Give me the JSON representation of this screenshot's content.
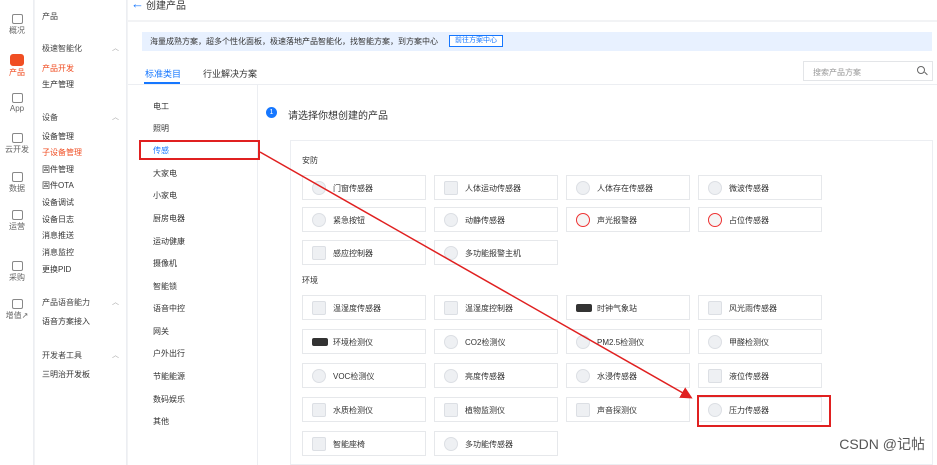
{
  "rail": [
    {
      "name": "rail-overview",
      "label": "概况",
      "active": false
    },
    {
      "name": "rail-product",
      "label": "产品",
      "active": true
    },
    {
      "name": "rail-app",
      "label": "App",
      "active": false
    },
    {
      "name": "rail-cloud",
      "label": "云开发",
      "active": false
    },
    {
      "name": "rail-data",
      "label": "数据",
      "active": false
    },
    {
      "name": "rail-ops",
      "label": "运营",
      "active": false
    },
    {
      "name": "rail-purchase",
      "label": "采购",
      "active": false
    },
    {
      "name": "rail-value-add",
      "label": "增值↗",
      "active": false
    }
  ],
  "menu": {
    "section_product": "产品",
    "group_fast": "极速智能化",
    "item_dev": "产品开发",
    "item_manage": "生产管理",
    "group_device": "设备",
    "device_items": [
      "设备管理",
      "子设备管理",
      "固件管理",
      "固件OTA",
      "设备调试",
      "设备日志",
      "消息推送",
      "消息监控",
      "更换PID"
    ],
    "group_voice": "产品语音能力",
    "voice_item": "语音方案接入",
    "group_dev_tools": "开发者工具",
    "dev_item": "三明治开发板"
  },
  "top": {
    "back_icon": "←",
    "title": "创建产品"
  },
  "banner": {
    "text": "海量成熟方案，超多个性化面板，极速落地产品智能化，找智能方案，到方案中心",
    "button": "前往方案中心"
  },
  "tabs": [
    "标准类目",
    "行业解决方案"
  ],
  "search": {
    "placeholder": "搜索产品方案"
  },
  "categories": [
    "电工",
    "照明",
    "传感",
    "大家电",
    "小家电",
    "厨房电器",
    "运动健康",
    "摄像机",
    "智能锁",
    "语音中控",
    "网关",
    "户外出行",
    "节能能源",
    "数码娱乐",
    "其他"
  ],
  "step": {
    "num": "1",
    "text": "请选择你想创建的产品"
  },
  "groups": {
    "security": {
      "title": "安防",
      "products": [
        "门窗传感器",
        "人体运动传感器",
        "人体存在传感器",
        "微波传感器",
        "紧急按钮",
        "动静传感器",
        "声光报警器",
        "占位传感器",
        "感应控制器",
        "多功能报警主机"
      ]
    },
    "environment": {
      "title": "环境",
      "products": [
        "温湿度传感器",
        "温湿度控制器",
        "时钟气象站",
        "风光雨传感器",
        "环境检测仪",
        "CO2检测仪",
        "PM2.5检测仪",
        "甲醛检测仪",
        "VOC检测仪",
        "亮度传感器",
        "水浸传感器",
        "液位传感器",
        "水质检测仪",
        "植物监测仪",
        "声音探测仪",
        "压力传感器",
        "智能座椅",
        "多功能传感器"
      ]
    }
  },
  "watermark": "CSDN @记帖",
  "colors": {
    "accent": "#1677ff",
    "brand": "#f04e23",
    "highlight": "#e02020"
  }
}
